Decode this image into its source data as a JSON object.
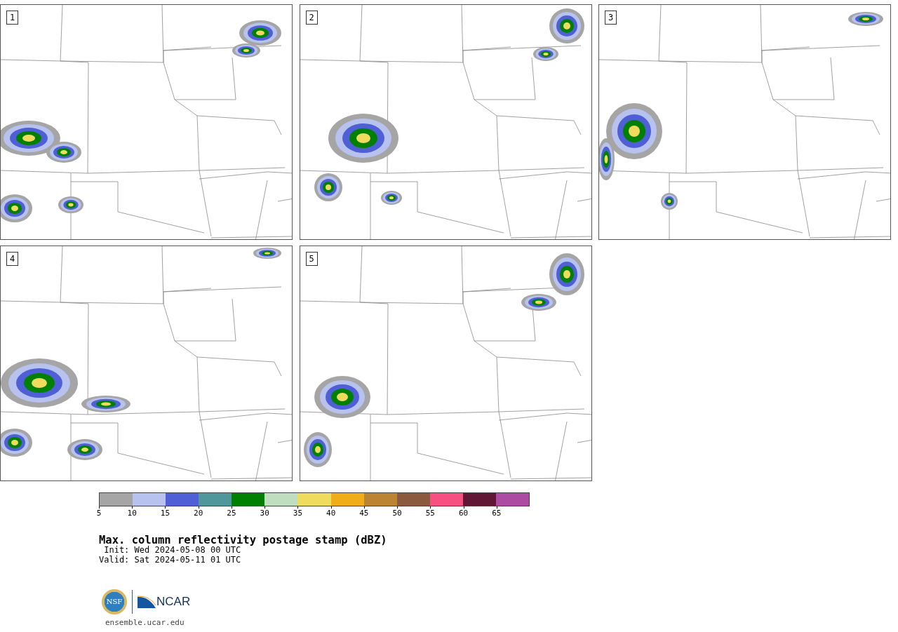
{
  "panels": [
    {
      "number": "1"
    },
    {
      "number": "2"
    },
    {
      "number": "3"
    },
    {
      "number": "4"
    },
    {
      "number": "5"
    }
  ],
  "colorbar": {
    "segments": [
      {
        "color": "#a5a5a5"
      },
      {
        "color": "#b8c2ef"
      },
      {
        "color": "#4f5fd6"
      },
      {
        "color": "#50979b"
      },
      {
        "color": "#008000"
      },
      {
        "color": "#bfddbf"
      },
      {
        "color": "#efdc5e"
      },
      {
        "color": "#f0ad17"
      },
      {
        "color": "#bb8433"
      },
      {
        "color": "#8b5a3e"
      },
      {
        "color": "#f65080"
      },
      {
        "color": "#5f1735"
      },
      {
        "color": "#ad4aa2"
      }
    ],
    "ticks": [
      "5",
      "10",
      "15",
      "20",
      "25",
      "30",
      "35",
      "40",
      "45",
      "50",
      "55",
      "60",
      "65"
    ]
  },
  "title": "Max. column reflectivity postage stamp (dBZ)",
  "init": " Init: Wed 2024-05-08 00 UTC",
  "valid": "Valid: Sat 2024-05-11 01 UTC",
  "logo": {
    "seal": "NSF",
    "wordmark": "NCAR"
  },
  "footer": "ensemble.ucar.edu"
}
